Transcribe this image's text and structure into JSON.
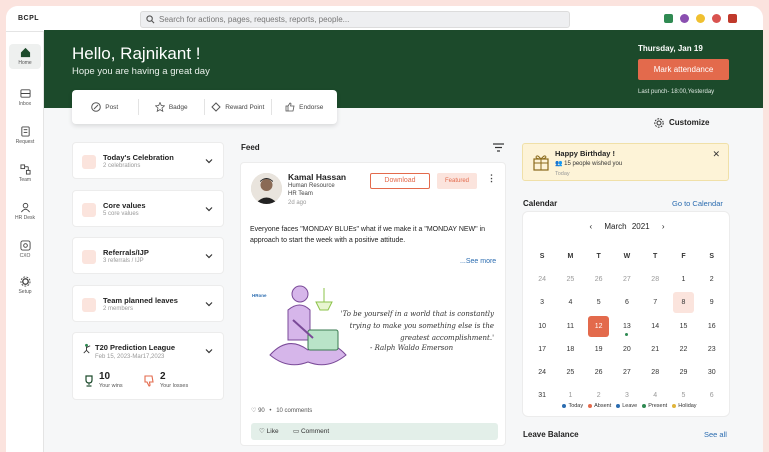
{
  "brand": "BCPL",
  "search": {
    "placeholder": "Search for actions, pages, requests, reports, people..."
  },
  "sidebar": {
    "items": [
      {
        "label": "Home",
        "icon": "home-icon",
        "active": true
      },
      {
        "label": "Inbox",
        "icon": "inbox-icon"
      },
      {
        "label": "Request",
        "icon": "request-icon"
      },
      {
        "label": "Team",
        "icon": "team-icon"
      },
      {
        "label": "HR Desk",
        "icon": "hr-desk-icon"
      },
      {
        "label": "CXO",
        "icon": "cxo-icon"
      },
      {
        "label": "Setup",
        "icon": "setup-icon"
      }
    ]
  },
  "hero": {
    "greeting": "Hello, Rajnikant !",
    "subtext": "Hope you are having a great day",
    "date": "Thursday, Jan 19",
    "mark_attendance": "Mark attendance",
    "last_punch": "Last punch- 18:00,Yesterday"
  },
  "quick_actions": [
    {
      "label": "Post",
      "icon": "pen-icon"
    },
    {
      "label": "Badge",
      "icon": "badge-icon"
    },
    {
      "label": "Reward Point",
      "icon": "reward-icon"
    },
    {
      "label": "Endorse",
      "icon": "thumbs-up-icon"
    }
  ],
  "left_cards": [
    {
      "title": "Today's Celebration",
      "sub": "2 celebrations"
    },
    {
      "title": "Core values",
      "sub": "5 core values"
    },
    {
      "title": "Referrals/IJP",
      "sub": "3 referrals / IJP"
    },
    {
      "title": "Team planned leaves",
      "sub": "2 members"
    }
  ],
  "t20": {
    "title": "T20 Prediction League",
    "dates": "Feb 15, 2023-Mar17,2023",
    "wins": "10",
    "wins_label": "Your wins",
    "losses": "2",
    "losses_label": "Your losses"
  },
  "feed": {
    "title": "Feed",
    "post": {
      "name": "Kamal Hassan",
      "role": "Human Resource",
      "team": "HR Team",
      "time": "2d ago",
      "download": "Download",
      "featured": "Featured",
      "text": "Everyone faces \"MONDAY BLUEs\" what if we make it a \"MONDAY NEW\" in approach to start the week with a positive attitude.",
      "see_more": "...See more",
      "image_brand": "HRone",
      "quote": "'To be yourself in a world that is constantly trying to make you something else is the greatest accomplishment.'",
      "author": "- Ralph Waldo Emerson",
      "likes": "90",
      "comments": "10 comments",
      "like_label": "Like",
      "comment_label": "Comment"
    }
  },
  "customize": "Customize",
  "birthday": {
    "title": "Happy Birthday !",
    "wishes": "15 people wished you",
    "when": "Today"
  },
  "calendar": {
    "title": "Calendar",
    "goto": "Go to Calendar",
    "month": "March",
    "year": "2021",
    "weekdays": [
      "S",
      "M",
      "T",
      "W",
      "T",
      "F",
      "S"
    ],
    "weeks": [
      [
        "24",
        "25",
        "26",
        "27",
        "28",
        "1",
        "2"
      ],
      [
        "3",
        "4",
        "5",
        "6",
        "7",
        "8",
        "9"
      ],
      [
        "10",
        "11",
        "12",
        "13",
        "14",
        "15",
        "16"
      ],
      [
        "17",
        "18",
        "19",
        "20",
        "21",
        "22",
        "23"
      ],
      [
        "24",
        "25",
        "26",
        "27",
        "28",
        "29",
        "30"
      ],
      [
        "31",
        "1",
        "2",
        "3",
        "4",
        "5",
        "6"
      ]
    ],
    "legend": [
      {
        "label": "Today",
        "color": "#2b6cb0"
      },
      {
        "label": "Absent",
        "color": "#e36a4c"
      },
      {
        "label": "Leave",
        "color": "#2b6cb0"
      },
      {
        "label": "Present",
        "color": "#2f8a52"
      },
      {
        "label": "Holiday",
        "color": "#e0b43a"
      }
    ]
  },
  "leave_balance": {
    "title": "Leave Balance",
    "see_all": "See all"
  }
}
